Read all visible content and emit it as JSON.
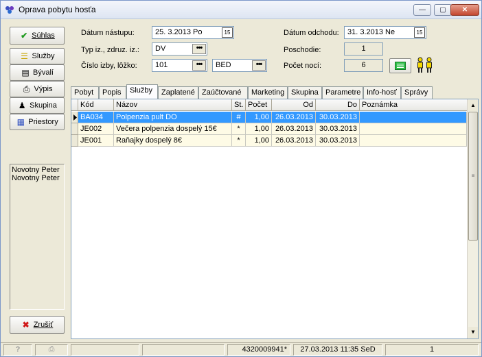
{
  "window": {
    "title": "Oprava pobytu hosťa",
    "min_glyph": "—",
    "max_glyph": "▢",
    "close_glyph": "✕"
  },
  "sidebar": {
    "buttons": [
      {
        "label": "Súhlas",
        "icon": "check-icon",
        "glyph": "✔"
      },
      {
        "label": "Služby",
        "icon": "services-icon",
        "glyph": "☰"
      },
      {
        "label": "Bývalí",
        "icon": "history-icon",
        "glyph": "▤"
      },
      {
        "label": "Výpis",
        "icon": "printer-icon",
        "glyph": "⎙"
      },
      {
        "label": "Skupina",
        "icon": "group-icon",
        "glyph": "♟"
      },
      {
        "label": "Priestory",
        "icon": "grid-icon",
        "glyph": "▦"
      }
    ],
    "guests": [
      "Novotny Peter",
      "Novotny Peter"
    ],
    "cancel": {
      "label": "Zrušiť",
      "icon": "cancel-icon",
      "glyph": "✖"
    }
  },
  "form": {
    "arrival_label": "Dátum nástupu:",
    "arrival_value": "25. 3.2013  Po",
    "departure_label": "Dátum odchodu:",
    "departure_value": "31. 3.2013  Ne",
    "type_label": "Typ iz., zdruz. iz.:",
    "type_value": "DV",
    "floor_label": "Poschodie:",
    "floor_value": "1",
    "room_label": "Číslo izby, lôžko:",
    "room_value": "101",
    "bed_value": "BED",
    "nights_label": "Počet nocí:",
    "nights_value": "6",
    "calendar_glyph": "15",
    "dots_glyph": "•••"
  },
  "tabs": [
    "Pobyt",
    "Popis",
    "Služby",
    "Zaplatené",
    "Zaúčtované",
    "Marketing",
    "Skupina",
    "Parametre",
    "Info-hosť",
    "Správy"
  ],
  "active_tab": "Služby",
  "table": {
    "columns": [
      "Kód",
      "Názov",
      "St.",
      "Počet",
      "Od",
      "Do",
      "Poznámka"
    ],
    "rows": [
      {
        "code": "BA034",
        "name": "Polpenzia pult DO",
        "st": "#",
        "count": "1,00",
        "from": "26.03.2013",
        "to": "30.03.2013",
        "note": ""
      },
      {
        "code": "JE002",
        "name": "Večera polpenzia dospelý 15€",
        "st": "*",
        "count": "1,00",
        "from": "26.03.2013",
        "to": "30.03.2013",
        "note": ""
      },
      {
        "code": "JE001",
        "name": "Raňajky dospelý 8€",
        "st": "*",
        "count": "1,00",
        "from": "26.03.2013",
        "to": "30.03.2013",
        "note": ""
      }
    ]
  },
  "statusbar": {
    "help_glyph": "?",
    "print_glyph": "⎙",
    "code": "4320009941*",
    "datetime": "27.03.2013 11:35 SeD",
    "count": "1"
  },
  "colors": {
    "selected_row": "#3399ff",
    "row_bg": "#fefbe6",
    "window_bg": "#ece9d8"
  }
}
